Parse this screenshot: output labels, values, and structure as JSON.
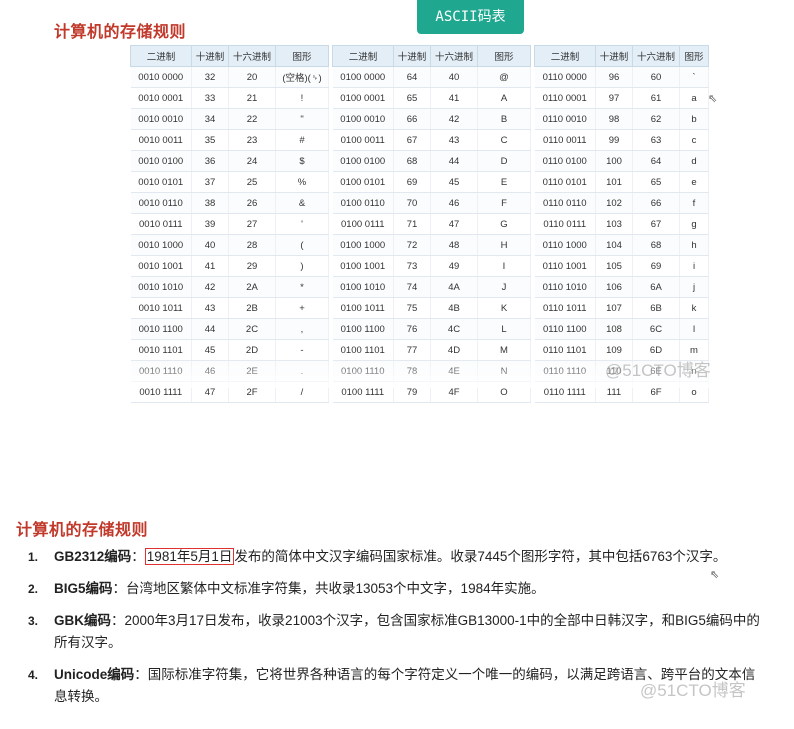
{
  "top_heading": "计算机的存储规则",
  "ascii_tab": "ASCII码表",
  "table_headers": [
    "二进制",
    "十进制",
    "十六进制",
    "图形"
  ],
  "tables": [
    {
      "rows": [
        [
          "0010 0000",
          "32",
          "20",
          "(空格)(␠)"
        ],
        [
          "0010 0001",
          "33",
          "21",
          "!"
        ],
        [
          "0010 0010",
          "34",
          "22",
          "\""
        ],
        [
          "0010 0011",
          "35",
          "23",
          "#"
        ],
        [
          "0010 0100",
          "36",
          "24",
          "$"
        ],
        [
          "0010 0101",
          "37",
          "25",
          "%"
        ],
        [
          "0010 0110",
          "38",
          "26",
          "&"
        ],
        [
          "0010 0111",
          "39",
          "27",
          "'"
        ],
        [
          "0010 1000",
          "40",
          "28",
          "("
        ],
        [
          "0010 1001",
          "41",
          "29",
          ")"
        ],
        [
          "0010 1010",
          "42",
          "2A",
          "*"
        ],
        [
          "0010 1011",
          "43",
          "2B",
          "+"
        ],
        [
          "0010 1100",
          "44",
          "2C",
          ","
        ],
        [
          "0010 1101",
          "45",
          "2D",
          "-"
        ],
        [
          "0010 1110",
          "46",
          "2E",
          "."
        ],
        [
          "0010 1111",
          "47",
          "2F",
          "/"
        ]
      ]
    },
    {
      "rows": [
        [
          "0100 0000",
          "64",
          "40",
          "@"
        ],
        [
          "0100 0001",
          "65",
          "41",
          "A"
        ],
        [
          "0100 0010",
          "66",
          "42",
          "B"
        ],
        [
          "0100 0011",
          "67",
          "43",
          "C"
        ],
        [
          "0100 0100",
          "68",
          "44",
          "D"
        ],
        [
          "0100 0101",
          "69",
          "45",
          "E"
        ],
        [
          "0100 0110",
          "70",
          "46",
          "F"
        ],
        [
          "0100 0111",
          "71",
          "47",
          "G"
        ],
        [
          "0100 1000",
          "72",
          "48",
          "H"
        ],
        [
          "0100 1001",
          "73",
          "49",
          "I"
        ],
        [
          "0100 1010",
          "74",
          "4A",
          "J"
        ],
        [
          "0100 1011",
          "75",
          "4B",
          "K"
        ],
        [
          "0100 1100",
          "76",
          "4C",
          "L"
        ],
        [
          "0100 1101",
          "77",
          "4D",
          "M"
        ],
        [
          "0100 1110",
          "78",
          "4E",
          "N"
        ],
        [
          "0100 1111",
          "79",
          "4F",
          "O"
        ]
      ]
    },
    {
      "rows": [
        [
          "0110 0000",
          "96",
          "60",
          "`"
        ],
        [
          "0110 0001",
          "97",
          "61",
          "a"
        ],
        [
          "0110 0010",
          "98",
          "62",
          "b"
        ],
        [
          "0110 0011",
          "99",
          "63",
          "c"
        ],
        [
          "0110 0100",
          "100",
          "64",
          "d"
        ],
        [
          "0110 0101",
          "101",
          "65",
          "e"
        ],
        [
          "0110 0110",
          "102",
          "66",
          "f"
        ],
        [
          "0110 0111",
          "103",
          "67",
          "g"
        ],
        [
          "0110 1000",
          "104",
          "68",
          "h"
        ],
        [
          "0110 1001",
          "105",
          "69",
          "i"
        ],
        [
          "0110 1010",
          "106",
          "6A",
          "j"
        ],
        [
          "0110 1011",
          "107",
          "6B",
          "k"
        ],
        [
          "0110 1100",
          "108",
          "6C",
          "l"
        ],
        [
          "0110 1101",
          "109",
          "6D",
          "m"
        ],
        [
          "0110 1110",
          "110",
          "6E",
          "n"
        ],
        [
          "0110 1111",
          "111",
          "6F",
          "o"
        ]
      ]
    }
  ],
  "watermark": "@51CTO博客",
  "section_heading": "计算机的存储规则",
  "rules": [
    {
      "num": "1.",
      "name": "GB2312编码",
      "sep": "：",
      "boxed": "1981年5月1日",
      "text": "发布的简体中文汉字编码国家标准。收录7445个图形字符，其中包括6763个汉字。"
    },
    {
      "num": "2.",
      "name": "BIG5编码",
      "sep": "：",
      "boxed": "",
      "text": "台湾地区繁体中文标准字符集，共收录13053个中文字，1984年实施。"
    },
    {
      "num": "3.",
      "name": "GBK编码",
      "sep": "：",
      "boxed": "",
      "text": "2000年3月17日发布，收录21003个汉字，包含国家标准GB13000-1中的全部中日韩汉字，和BIG5编码中的所有汉字。"
    },
    {
      "num": "4.",
      "name": "Unicode编码",
      "sep": "：",
      "boxed": "",
      "text": "国际标准字符集，它将世界各种语言的每个字符定义一个唯一的编码，以满足跨语言、跨平台的文本信息转换。"
    }
  ]
}
